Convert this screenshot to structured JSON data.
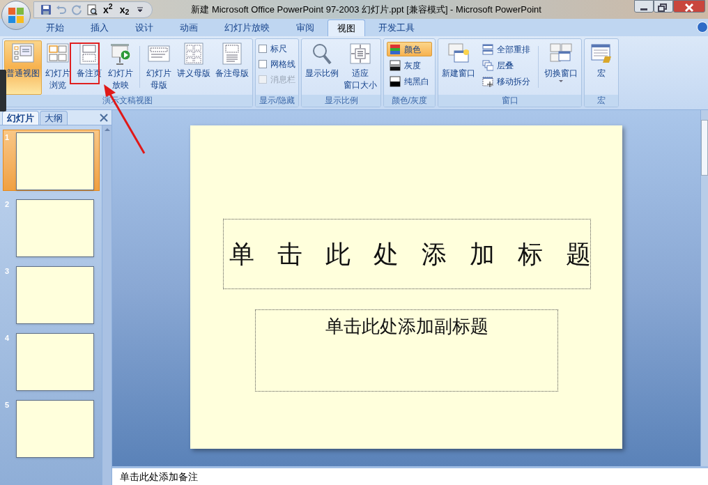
{
  "window": {
    "title": "新建 Microsoft Office PowerPoint 97-2003 幻灯片.ppt [兼容模式] - Microsoft PowerPoint"
  },
  "quick_access": [
    {
      "kind": "save"
    },
    {
      "kind": "undo"
    },
    {
      "kind": "redo"
    },
    {
      "kind": "preview"
    },
    {
      "kind": "script",
      "label": "x$^{2}$"
    },
    {
      "kind": "script",
      "label": "x$_{2}$"
    },
    {
      "kind": "customize"
    }
  ],
  "tabs": [
    {
      "label": "开始",
      "selected": false
    },
    {
      "label": "插入",
      "selected": false
    },
    {
      "label": "设计",
      "selected": false
    },
    {
      "label": "动画",
      "selected": false
    },
    {
      "label": "幻灯片放映",
      "selected": false
    },
    {
      "label": "审阅",
      "selected": false
    },
    {
      "label": "视图",
      "selected": true
    },
    {
      "label": "开发工具",
      "selected": false
    }
  ],
  "ribbon": [
    {
      "label": "演示文稿视图",
      "items": [
        {
          "kind": "large",
          "lines": [
            "普通视图"
          ],
          "selected": true
        },
        {
          "kind": "large",
          "lines": [
            "幻灯片",
            "浏览"
          ],
          "selected": false
        },
        {
          "kind": "large",
          "lines": [
            "备注页"
          ],
          "selected": false
        },
        {
          "kind": "large",
          "lines": [
            "幻灯片",
            "放映"
          ],
          "selected": false
        },
        {
          "kind": "separator"
        },
        {
          "kind": "large",
          "lines": [
            "幻灯片",
            "母版"
          ],
          "selected": false
        },
        {
          "kind": "large",
          "lines": [
            "讲义母版"
          ],
          "selected": false
        },
        {
          "kind": "large",
          "lines": [
            "备注母版"
          ],
          "selected": false
        }
      ]
    },
    {
      "label": "显示/隐藏",
      "items": [
        {
          "kind": "check",
          "label": "标尺",
          "checked": false,
          "disabled": false
        },
        {
          "kind": "check",
          "label": "网格线",
          "checked": false,
          "disabled": false
        },
        {
          "kind": "check",
          "label": "消息栏",
          "checked": false,
          "disabled": true
        }
      ]
    },
    {
      "label": "显示比例",
      "items": [
        {
          "kind": "large",
          "lines": [
            "显示比例"
          ],
          "selected": false
        },
        {
          "kind": "large",
          "lines": [
            "适应",
            "窗口大小"
          ],
          "selected": false
        }
      ]
    },
    {
      "label": "颜色/灰度",
      "items": [
        {
          "kind": "small",
          "label": "颜色",
          "selected": true
        },
        {
          "kind": "small",
          "label": "灰度",
          "selected": false
        },
        {
          "kind": "small",
          "label": "纯黑白",
          "selected": false
        }
      ]
    },
    {
      "label": "窗口",
      "items": [
        {
          "kind": "large",
          "lines": [
            "新建窗口"
          ],
          "selected": false
        },
        {
          "kind": "small",
          "label": "全部重排",
          "selected": false
        },
        {
          "kind": "small",
          "label": "层叠",
          "selected": false
        },
        {
          "kind": "small",
          "label": "移动拆分",
          "selected": false
        },
        {
          "kind": "separator"
        },
        {
          "kind": "dropdown",
          "lines": [
            "切换窗口"
          ],
          "selected": false
        }
      ]
    },
    {
      "label": "宏",
      "items": [
        {
          "kind": "large",
          "lines": [
            "宏"
          ],
          "selected": false
        }
      ]
    }
  ],
  "pane_tabs": [
    {
      "label": "幻灯片",
      "selected": true
    },
    {
      "label": "大纲",
      "selected": false
    }
  ],
  "thumbnails": [
    {
      "number": "1",
      "selected": true
    },
    {
      "number": "2",
      "selected": false
    },
    {
      "number": "3",
      "selected": false
    },
    {
      "number": "4",
      "selected": false
    },
    {
      "number": "5",
      "selected": false
    }
  ],
  "slide": {
    "title_placeholder": "单击此处添加标题",
    "subtitle_placeholder": "单击此处添加副标题"
  },
  "notes": {
    "placeholder": "单击此处添加备注"
  }
}
